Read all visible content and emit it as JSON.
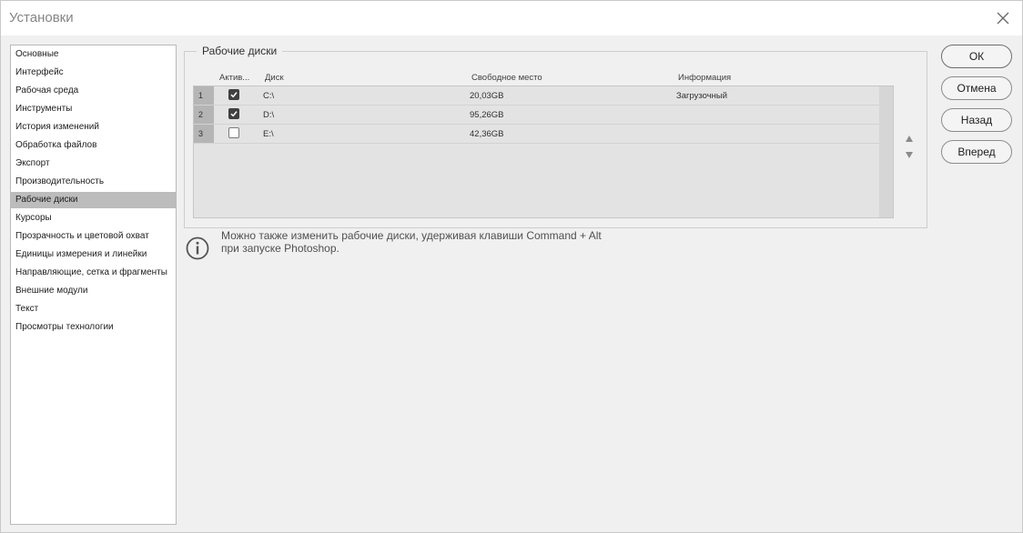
{
  "window": {
    "title": "Установки"
  },
  "sidebar": {
    "items": [
      {
        "label": "Основные"
      },
      {
        "label": "Интерфейс"
      },
      {
        "label": "Рабочая среда"
      },
      {
        "label": "Инструменты"
      },
      {
        "label": "История изменений"
      },
      {
        "label": "Обработка файлов"
      },
      {
        "label": "Экспорт"
      },
      {
        "label": "Производительность"
      },
      {
        "label": "Рабочие диски",
        "selected": true
      },
      {
        "label": "Курсоры"
      },
      {
        "label": "Прозрачность и цветовой охват"
      },
      {
        "label": "Единицы измерения и линейки"
      },
      {
        "label": "Направляющие, сетка и фрагменты"
      },
      {
        "label": "Внешние модули"
      },
      {
        "label": "Текст"
      },
      {
        "label": "Просмотры технологии"
      }
    ]
  },
  "scratch": {
    "group_title": "Рабочие диски",
    "headers": {
      "active": "Актив...",
      "disk": "Диск",
      "free": "Свободное место",
      "info": "Информация"
    },
    "rows": [
      {
        "num": "1",
        "active": true,
        "disk": "C:\\",
        "free": "20,03GB",
        "info": "Загрузочный"
      },
      {
        "num": "2",
        "active": true,
        "disk": "D:\\",
        "free": "95,26GB",
        "info": ""
      },
      {
        "num": "3",
        "active": false,
        "disk": "E:\\",
        "free": "42,36GB",
        "info": ""
      }
    ],
    "move_up_icon": "triangle-up-icon",
    "move_down_icon": "triangle-down-icon"
  },
  "note": {
    "line1": "Можно также изменить рабочие диски, удерживая клавиши Command + Alt",
    "line2": "при запуске Photoshop.",
    "icon": "info-icon"
  },
  "buttons": {
    "ok": "ОК",
    "cancel": "Отмена",
    "back": "Назад",
    "forward": "Вперед"
  },
  "colors": {
    "selected_item": "#bcbcbc",
    "window_bg": "#f0f0f0",
    "checkbox_on": "#404040"
  }
}
